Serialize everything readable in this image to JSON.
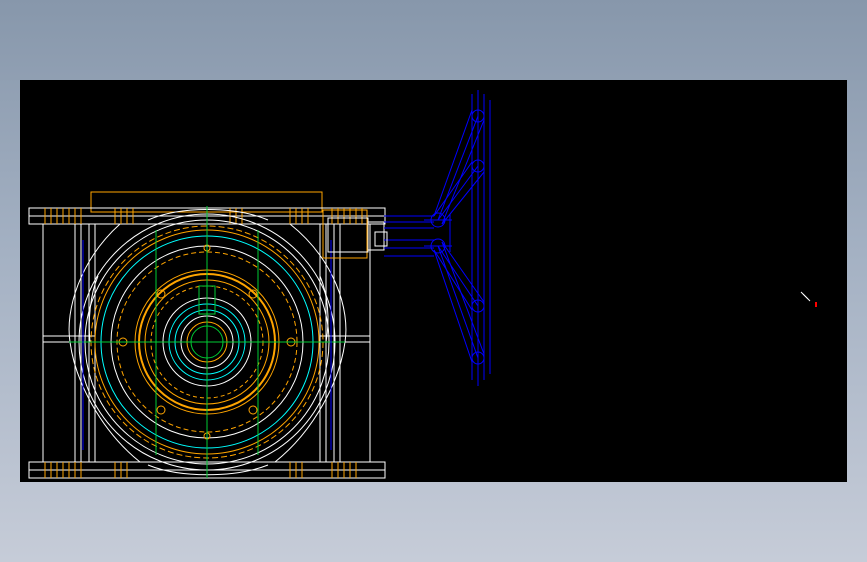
{
  "viewer": {
    "background": "#000000",
    "page_background_top": "#8797ab",
    "page_background_bottom": "#c6ccd8"
  },
  "drawing": {
    "colors": {
      "frame": "#ffffff",
      "body": "#ffffff",
      "orange": "#ffa500",
      "cyan": "#00ffff",
      "green": "#00cc33",
      "blue": "#0000ff",
      "red": "#ff0000"
    },
    "components": [
      "gearbox-front-view",
      "flange-top",
      "flange-bottom",
      "input-shaft",
      "handwheel-side-view"
    ]
  },
  "cursor": {
    "icon": "cad-cursor-icon"
  }
}
